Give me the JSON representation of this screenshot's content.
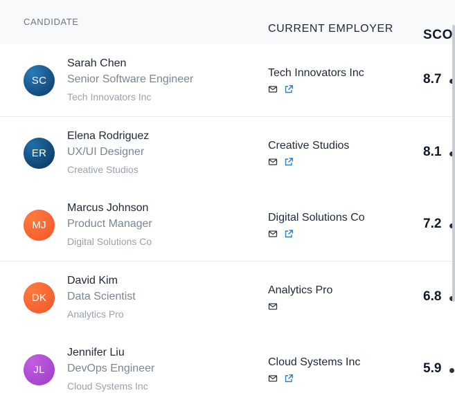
{
  "header": {
    "candidate": "CANDIDATE",
    "employer": "CURRENT EMPLOYER",
    "score": "SCORE"
  },
  "rows": [
    {
      "initials": "SC",
      "name": "Sarah Chen",
      "title": "Senior Software Engineer",
      "company": "Tech Innovators Inc",
      "employer": "Tech Innovators Inc",
      "score": "8.7",
      "avatar_colors": [
        "#2a7ab9",
        "#0b3a66"
      ],
      "icons": [
        "mail-icon",
        "external-link-icon"
      ]
    },
    {
      "initials": "ER",
      "name": "Elena Rodriguez",
      "title": "UX/UI Designer",
      "company": "Creative Studios",
      "employer": "Creative Studios",
      "score": "8.1",
      "avatar_colors": [
        "#1e6fa8",
        "#0a3358"
      ],
      "icons": [
        "mail-icon",
        "external-link-icon"
      ]
    },
    {
      "initials": "MJ",
      "name": "Marcus Johnson",
      "title": "Product Manager",
      "company": "Digital Solutions Co",
      "employer": "Digital Solutions Co",
      "score": "7.2",
      "avatar_colors": [
        "#ff7a3d",
        "#f0562a"
      ],
      "icons": [
        "mail-icon",
        "external-link-icon"
      ]
    },
    {
      "initials": "DK",
      "name": "David Kim",
      "title": "Data Scientist",
      "company": "Analytics Pro",
      "employer": "Analytics Pro",
      "score": "6.8",
      "avatar_colors": [
        "#ff7a3d",
        "#f0562a"
      ],
      "icons": [
        "mail-icon"
      ]
    },
    {
      "initials": "JL",
      "name": "Jennifer Liu",
      "title": "DevOps Engineer",
      "company": "Cloud Systems Inc",
      "employer": "Cloud Systems Inc",
      "score": "5.9",
      "avatar_colors": [
        "#c45de0",
        "#9a3cc8"
      ],
      "icons": [
        "mail-icon",
        "external-link-icon"
      ]
    }
  ],
  "colors": {
    "link_icon": "#2c7fc2",
    "mail_icon": "#2c3440"
  }
}
